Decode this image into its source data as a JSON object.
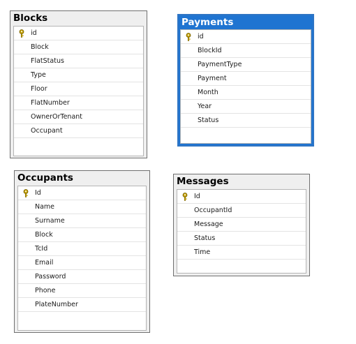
{
  "icons": {
    "primary_key": "key-icon",
    "key_color": "#c9a400"
  },
  "colors": {
    "selected_header": "#1f74d1",
    "header_gray": "#efefef"
  },
  "tables": {
    "blocks": {
      "title": "Blocks",
      "columns": [
        "id",
        "Block",
        "FlatStatus",
        "Type",
        "Floor",
        "FlatNumber",
        "OwnerOrTenant",
        "Occupant"
      ]
    },
    "payments": {
      "title": "Payments",
      "selected": true,
      "columns": [
        "id",
        "BlockId",
        "PaymentType",
        "Payment",
        "Month",
        "Year",
        "Status"
      ]
    },
    "occupants": {
      "title": "Occupants",
      "columns": [
        "Id",
        "Name",
        "Surname",
        "Block",
        "TcId",
        "Email",
        "Password",
        "Phone",
        "PlateNumber"
      ]
    },
    "messages": {
      "title": "Messages",
      "columns": [
        "Id",
        "OccupantId",
        "Message",
        "Status",
        "Time"
      ]
    }
  }
}
